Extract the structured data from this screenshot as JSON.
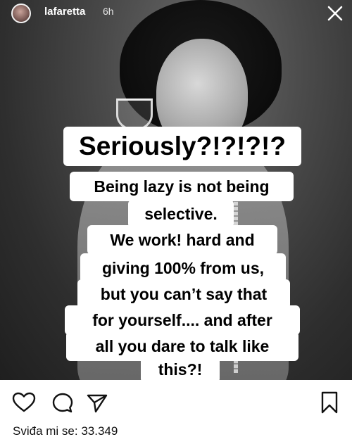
{
  "header": {
    "username": "lafaretta",
    "time_ago": "6h"
  },
  "story": {
    "lines": [
      "Seriously?!?!?!?",
      "Being lazy is not being",
      "selective.",
      "We work! hard and",
      "giving 100% from us,",
      "but you can’t say that",
      "for yourself.... and after",
      "all you dare to talk like",
      "this?!"
    ]
  },
  "footer": {
    "likes_label": "Sviđa mi se:",
    "likes_count": "33.349"
  },
  "icons": {
    "avatar": "avatar",
    "close": "close-icon",
    "like": "heart-icon",
    "comment": "comment-icon",
    "share": "share-icon",
    "save": "bookmark-icon"
  }
}
